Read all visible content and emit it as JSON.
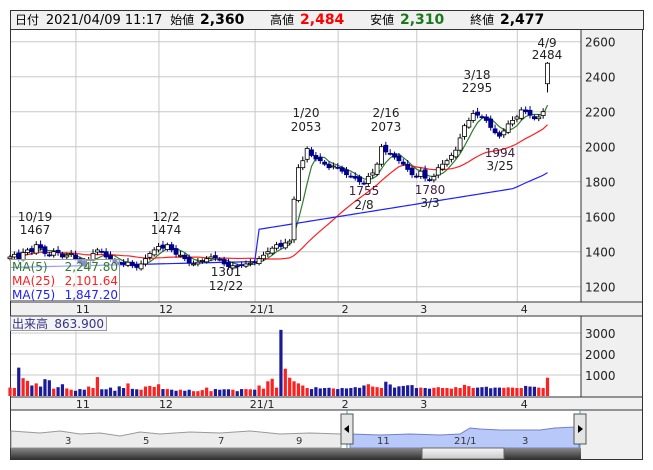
{
  "header": {
    "date_label": "日付",
    "datetime": "2021/04/09 11:17",
    "open_label": "始値",
    "open": "2,360",
    "high_label": "高値",
    "high": "2,484",
    "low_label": "安値",
    "low": "2,310",
    "close_label": "終値",
    "close": "2,477"
  },
  "colors": {
    "up_fill": "#ffffff",
    "down_fill": "#00008b",
    "ma5": "#2e7d2e",
    "ma25": "#ff2020",
    "ma75": "#2020ff",
    "vol_up": "#ff2020",
    "vol_down": "#1a1a9a",
    "high_value": "#ff0000",
    "low_value": "#1a7a1a"
  },
  "ma_legend": [
    {
      "label": "MA(5)",
      "value": "2,247.80"
    },
    {
      "label": "MA(25)",
      "value": "2,101.64"
    },
    {
      "label": "MA(75)",
      "value": "1,847.20"
    }
  ],
  "volume_legend": {
    "label": "出来高",
    "value": "863.900"
  },
  "navigator": {
    "labels": [
      "3",
      "5",
      "7",
      "9",
      "11",
      "21/1",
      "3"
    ]
  },
  "chart_data": {
    "type": "candlestick",
    "price_axis": {
      "ticks": [
        1200,
        1400,
        1600,
        1800,
        2000,
        2200,
        2400,
        2600
      ],
      "tick_labels": [
        "1200",
        "1400",
        "1600",
        "1800",
        "2000",
        "2200",
        "2400",
        "2600"
      ]
    },
    "volume_axis": {
      "ticks": [
        1000,
        2000,
        3000
      ],
      "tick_labels": [
        "1000",
        "2000",
        "3000"
      ]
    },
    "month_ticks": [
      {
        "index": 16,
        "label": "11"
      },
      {
        "index": 35,
        "label": "12"
      },
      {
        "index": 57,
        "label": "21/1"
      },
      {
        "index": 76,
        "label": "2"
      },
      {
        "index": 94,
        "label": "3"
      },
      {
        "index": 117,
        "label": "4"
      }
    ],
    "annotations": [
      {
        "date": "10/19",
        "value": "1467",
        "kind": "high"
      },
      {
        "date": "12/2",
        "value": "1474",
        "kind": "high"
      },
      {
        "date": "12/22",
        "value": "1301",
        "kind": "low"
      },
      {
        "date": "1/20",
        "value": "2053",
        "kind": "high"
      },
      {
        "date": "2/16",
        "value": "2073",
        "kind": "high"
      },
      {
        "date": "2/8",
        "value": "1755",
        "kind": "low"
      },
      {
        "date": "3/3",
        "value": "1780",
        "kind": "low"
      },
      {
        "date": "3/18",
        "value": "2295",
        "kind": "high"
      },
      {
        "date": "3/25",
        "value": "1994",
        "kind": "low"
      },
      {
        "date": "4/9",
        "value": "2484",
        "kind": "high"
      }
    ],
    "closes": [
      1370,
      1385,
      1360,
      1395,
      1410,
      1400,
      1440,
      1420,
      1390,
      1380,
      1400,
      1395,
      1370,
      1380,
      1390,
      1360,
      1340,
      1320,
      1350,
      1390,
      1410,
      1400,
      1370,
      1360,
      1340,
      1330,
      1330,
      1340,
      1320,
      1310,
      1330,
      1360,
      1390,
      1410,
      1430,
      1420,
      1440,
      1410,
      1385,
      1380,
      1360,
      1335,
      1330,
      1340,
      1350,
      1360,
      1370,
      1365,
      1355,
      1330,
      1315,
      1320,
      1318,
      1325,
      1330,
      1335,
      1340,
      1360,
      1380,
      1400,
      1420,
      1440,
      1430,
      1450,
      1460,
      1700,
      1880,
      1920,
      1990,
      1950,
      1930,
      1920,
      1900,
      1880,
      1890,
      1880,
      1860,
      1840,
      1830,
      1820,
      1800,
      1790,
      1830,
      1850,
      1900,
      2000,
      1970,
      1960,
      1940,
      1920,
      1900,
      1870,
      1840,
      1830,
      1860,
      1820,
      1810,
      1830,
      1880,
      1900,
      1920,
      1950,
      1980,
      2050,
      2120,
      2150,
      2190,
      2180,
      2170,
      2150,
      2110,
      2080,
      2060,
      2090,
      2130,
      2150,
      2170,
      2210,
      2200,
      2180,
      2160,
      2170,
      2200,
      2477
    ],
    "last_candle": {
      "open": 2360,
      "high": 2484,
      "low": 2310,
      "close": 2477
    },
    "volumes": [
      400,
      380,
      1350,
      850,
      720,
      500,
      600,
      450,
      800,
      750,
      350,
      420,
      560,
      360,
      300,
      250,
      330,
      300,
      450,
      380,
      900,
      320,
      320,
      400,
      250,
      460,
      380,
      600,
      340,
      320,
      300,
      450,
      480,
      430,
      560,
      330,
      330,
      300,
      250,
      300,
      250,
      300,
      230,
      230,
      280,
      400,
      230,
      330,
      300,
      320,
      320,
      300,
      230,
      330,
      330,
      320,
      300,
      500,
      350,
      700,
      820,
      400,
      3150,
      1300,
      870,
      700,
      600,
      500,
      380,
      330,
      420,
      360,
      380,
      390,
      360,
      330,
      380,
      360,
      380,
      420,
      390,
      500,
      560,
      450,
      420,
      380,
      680,
      550,
      400,
      460,
      480,
      510,
      520,
      380,
      400,
      380,
      350,
      390,
      420,
      380,
      380,
      350,
      420,
      380,
      530,
      470,
      380,
      400,
      420,
      440,
      370,
      400,
      400,
      390,
      410,
      400,
      380,
      380,
      480,
      450,
      440,
      400,
      380,
      870
    ]
  }
}
